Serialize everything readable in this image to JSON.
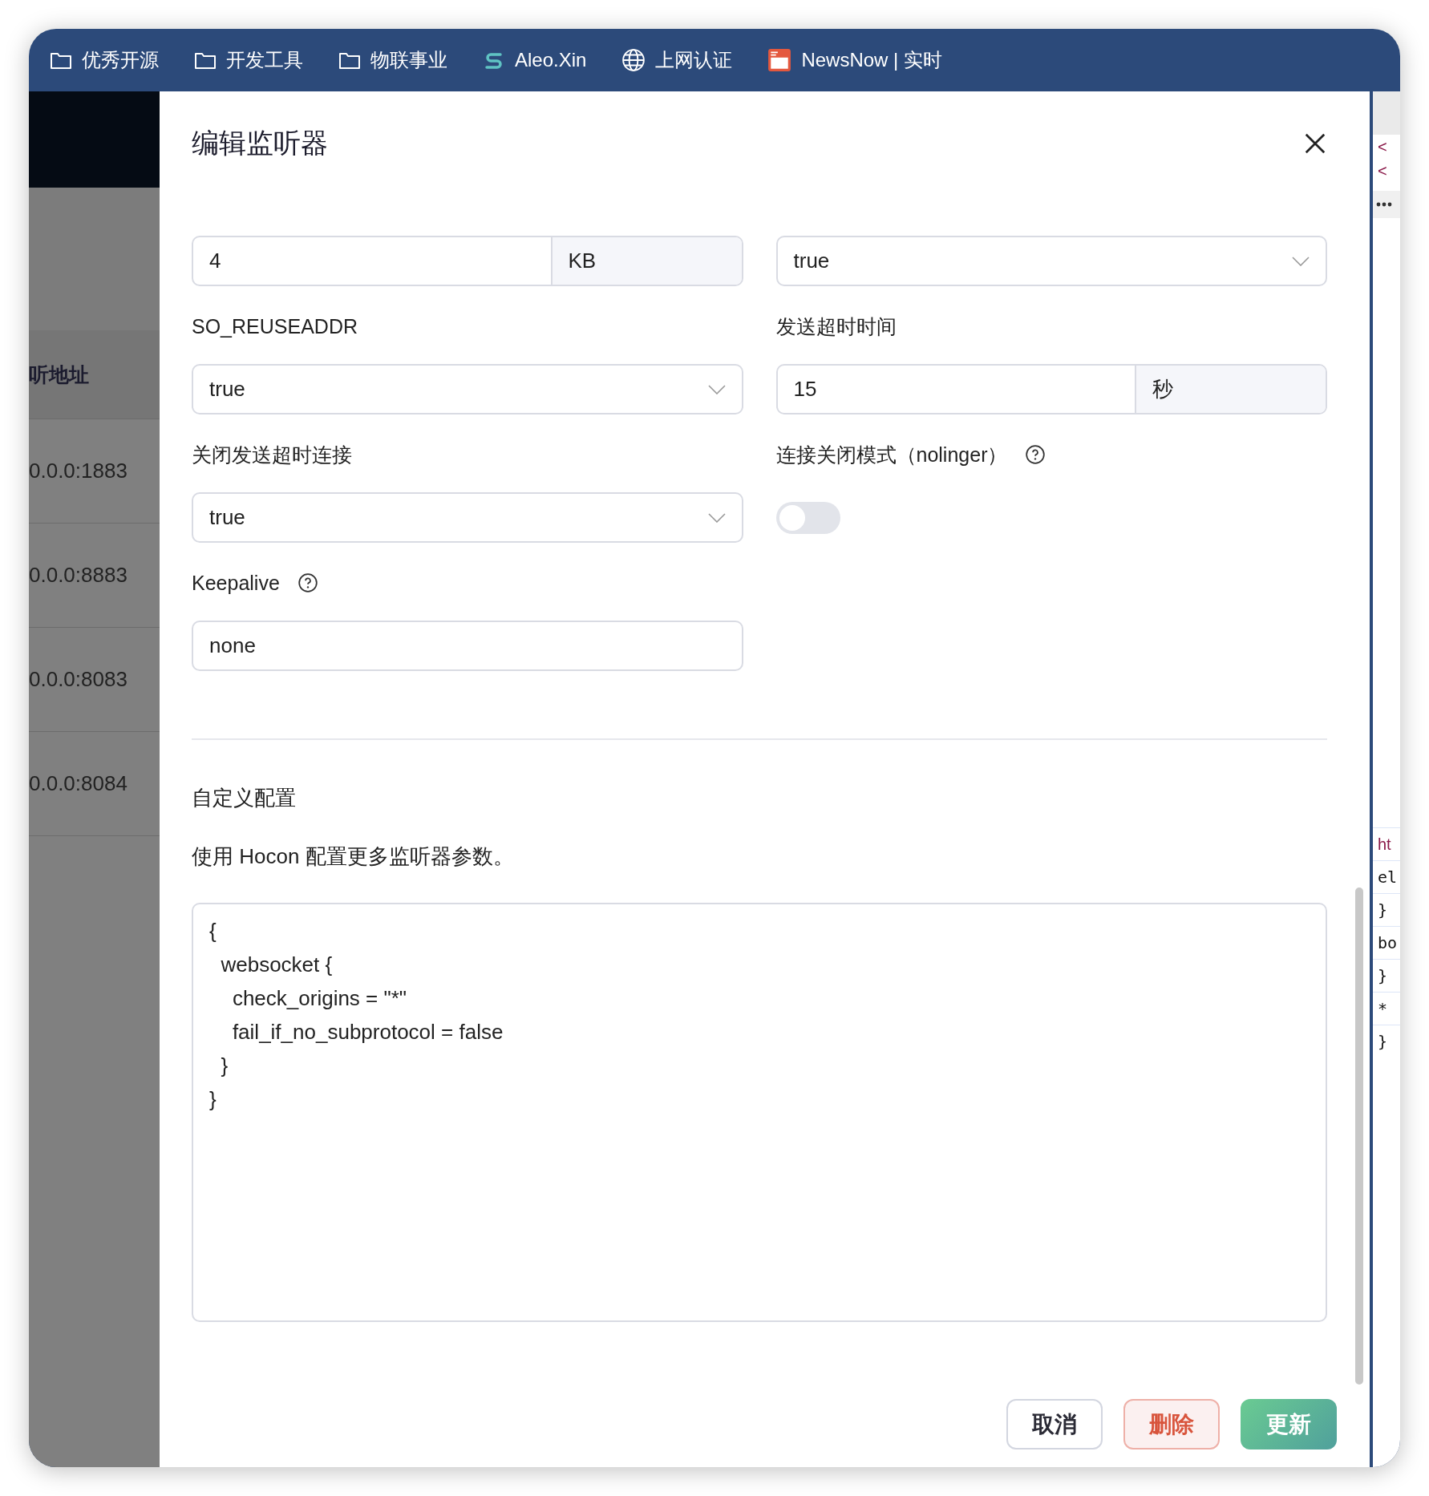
{
  "bookmarks": [
    {
      "label": "优秀开源",
      "kind": "folder"
    },
    {
      "label": "开发工具",
      "kind": "folder"
    },
    {
      "label": "物联事业",
      "kind": "folder"
    },
    {
      "label": "Aleo.Xin",
      "kind": "logo"
    },
    {
      "label": "上网认证",
      "kind": "globe"
    },
    {
      "label": "NewsNow | 实时",
      "kind": "news"
    }
  ],
  "background_table": {
    "header": "听地址",
    "rows": [
      "0.0.0:1883",
      "0.0.0:8883",
      "0.0.0:8083",
      "0.0.0:8084"
    ]
  },
  "dialog": {
    "title": "编辑监听器",
    "fields": [
      {
        "kind": "unit-input",
        "value": "4",
        "unit": "KB"
      },
      {
        "kind": "select",
        "value": "true"
      },
      {
        "kind": "select",
        "label": "SO_REUSEADDR",
        "value": "true"
      },
      {
        "kind": "unit-input",
        "label": "发送超时时间",
        "value": "15",
        "unit": "秒"
      },
      {
        "kind": "select",
        "label": "关闭发送超时连接",
        "value": "true"
      },
      {
        "kind": "toggle",
        "label": "连接关闭模式（nolinger）",
        "help": true,
        "on": false
      },
      {
        "kind": "input",
        "label": "Keepalive",
        "help": true,
        "value": "none"
      }
    ],
    "custom_config": {
      "title": "自定义配置",
      "description": "使用 Hocon 配置更多监听器参数。",
      "value": "{\n  websocket {\n    check_origins = \"*\"\n    fail_if_no_subprotocol = false\n  }\n}"
    },
    "buttons": [
      {
        "label": "取消",
        "kind": "default"
      },
      {
        "label": "删除",
        "kind": "danger"
      },
      {
        "label": "更新",
        "kind": "primary"
      }
    ]
  },
  "devtools": {
    "top_lines": [
      "<",
      "<"
    ],
    "lines": [
      "ht",
      "el",
      "}",
      "bo",
      "}",
      "*",
      "}"
    ]
  }
}
